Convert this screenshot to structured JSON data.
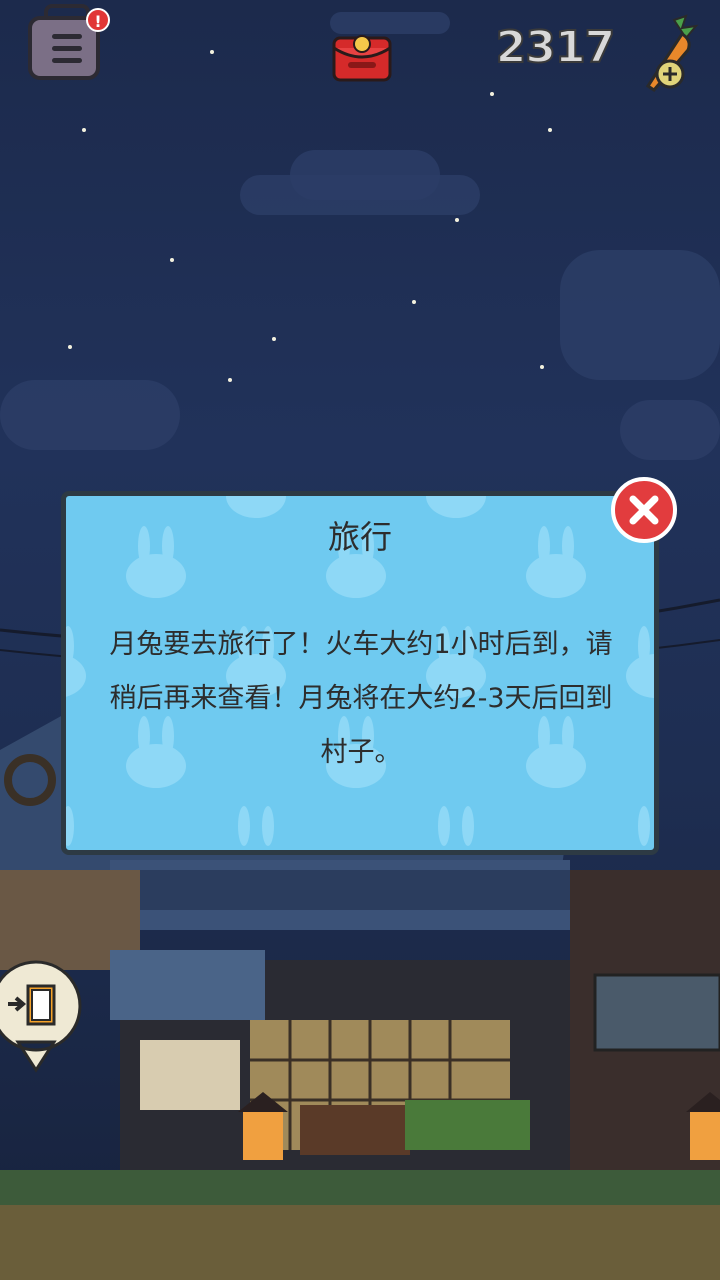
{
  "hud": {
    "menu_icon": "menu-list-icon",
    "menu_badge": "!",
    "redpacket_icon": "red-envelope-icon",
    "carrot_count": "2317",
    "carrot_icon": "carrot-add-icon"
  },
  "dialog": {
    "title": "旅行",
    "message": "月兔要去旅行了！火车大约1小时后到，请稍后再来查看！月兔将在大约2-3天后回到村子。",
    "close_icon": "close-x-icon"
  },
  "scene": {
    "door_icon": "exit-door-icon"
  },
  "colors": {
    "sky": "#1f2f56",
    "dialog_bg": "#6fcaf0",
    "close_red": "#e23c3e",
    "lantern": "#f0a040"
  }
}
